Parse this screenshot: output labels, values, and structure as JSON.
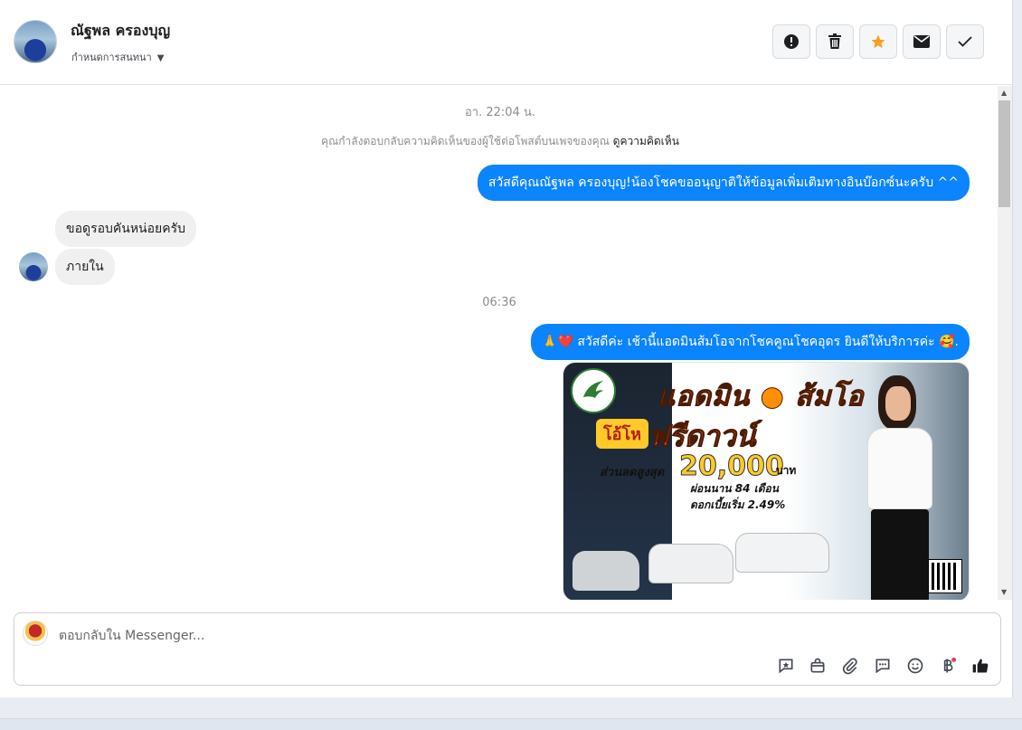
{
  "header": {
    "contact_name": "ณัฐพล ครองบุญ",
    "assign_label": "กำหนดการสนทนา",
    "actions": [
      "mark-spam",
      "delete",
      "star",
      "mark-unread",
      "mark-done"
    ]
  },
  "thread": {
    "timestamp_1": "อา. 22:04 น.",
    "system_note": "คุณกำลังตอบกลับความคิดเห็นของผู้ใช้ต่อโพสต์บนเพจของคุณ",
    "system_link": "ดูความคิดเห็น",
    "msg_out_1": "สวัสดีคุณณัฐพล ครองบุญ!น้องโชคขออนุญาติให้ข้อมูลเพิ่มเติมทางอินบ๊อกซ์นะครับ ^^",
    "msg_in_1": "ขอดูรอบคันหน่อยครับ",
    "msg_in_2": "ภายใน",
    "timestamp_2": "06:36",
    "msg_out_2": "🙏❤️ สวัสดีค่ะ เช้านี้แอดมินส้มโอจากโชคคูณโชคอุดร ยินดีให้บริการค่ะ 🥰.",
    "promo": {
      "title": "แอดมิน",
      "title2": "ส้มโอ",
      "offer_badge": "โอ้โห",
      "offer": "ฟรีดาวน์",
      "discount_label": "ส่วนลดสูงสุด",
      "amount": "20,000",
      "currency": "บาท",
      "term": "ผ่อนนาน 84 เดือน",
      "rate": "ดอกเบี้ยเริ่ม 2.49%"
    }
  },
  "composer": {
    "placeholder": "ตอบกลับใน Messenger..."
  },
  "colors": {
    "accent": "#0a84ff",
    "incoming_bubble": "#f0f0f0",
    "star": "#f7a21b"
  }
}
